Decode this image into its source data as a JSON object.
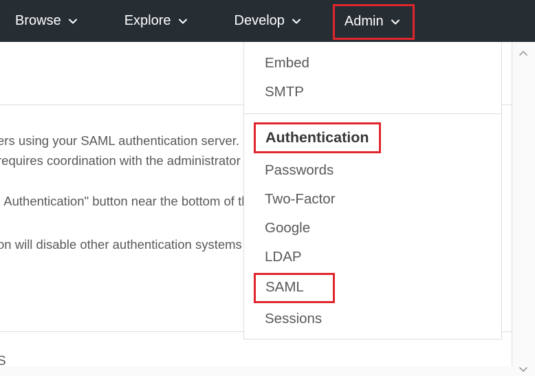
{
  "nav": {
    "browse": "Browse",
    "explore": "Explore",
    "develop": "Develop",
    "admin": "Admin"
  },
  "dropdown": {
    "cut_item": "…",
    "items_top": [
      "Embed",
      "SMTP"
    ],
    "section_header": "Authentication",
    "items_auth": [
      "Passwords",
      "Two-Factor",
      "Google",
      "LDAP"
    ],
    "saml": "SAML",
    "items_after": [
      "Sessions"
    ]
  },
  "bg": {
    "l1": "ers using your SAML authentication server.",
    "l2": " requires coordination with the administrator of your SAML authentication server.",
    "l3": ". Authentication\" button near the bottom of this page.",
    "l4": "on will disable other authentication systems such as your email and password.",
    "footer": "S"
  },
  "highlight_color": "#e0262d"
}
